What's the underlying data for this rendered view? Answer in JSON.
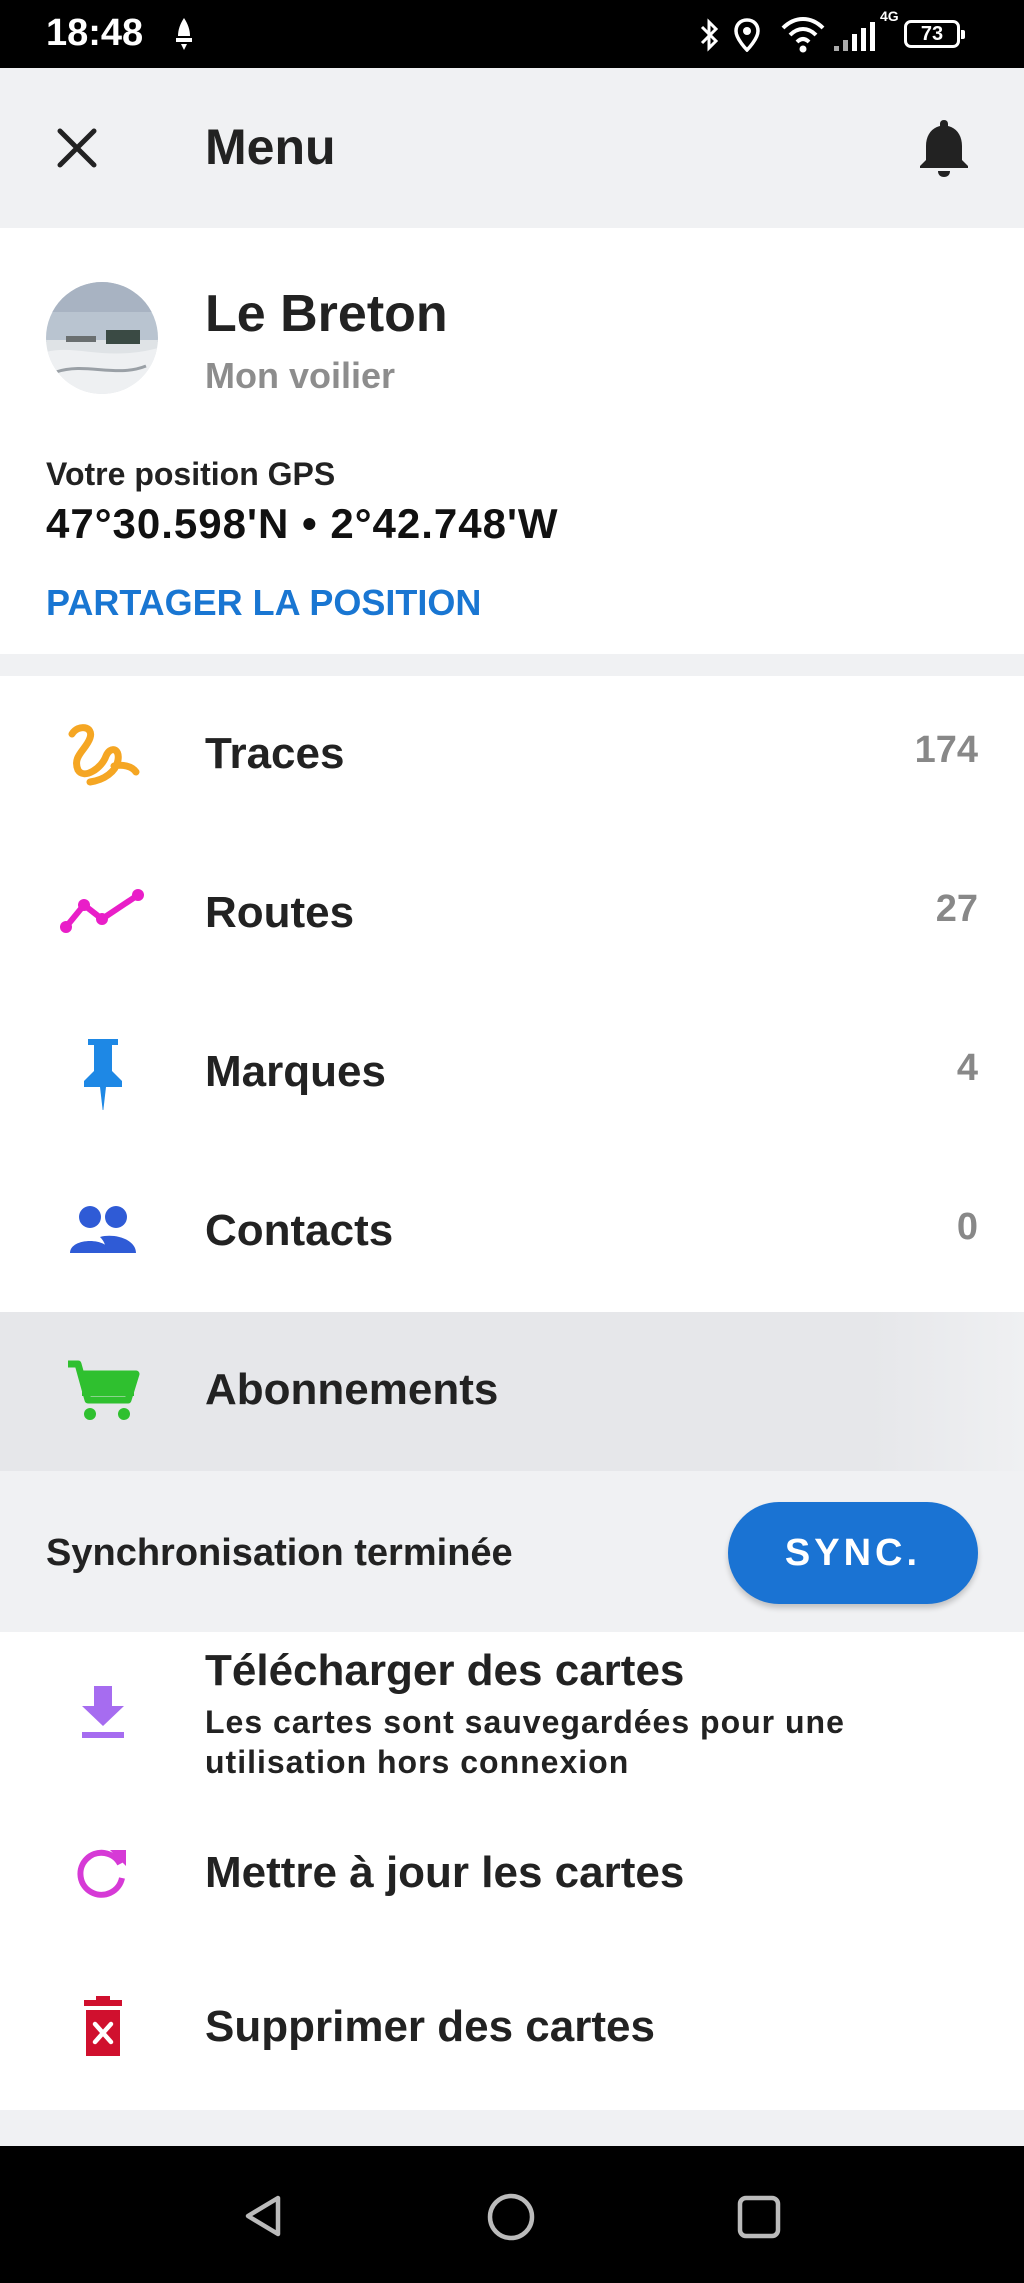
{
  "status_bar": {
    "time": "18:48",
    "battery": "73",
    "network": "4G"
  },
  "header": {
    "title": "Menu"
  },
  "profile": {
    "name": "Le Breton",
    "boat": "Mon voilier",
    "gps_label": "Votre position GPS",
    "gps_value": "47°30.598'N • 2°42.748'W",
    "share_label": "PARTAGER LA POSITION"
  },
  "menu": {
    "traces": {
      "label": "Traces",
      "count": "174"
    },
    "routes": {
      "label": "Routes",
      "count": "27"
    },
    "marques": {
      "label": "Marques",
      "count": "4"
    },
    "contacts": {
      "label": "Contacts",
      "count": "0"
    },
    "abonnements": {
      "label": "Abonnements"
    }
  },
  "sync": {
    "status": "Synchronisation terminée",
    "button": "SYNC."
  },
  "maps": {
    "download_title": "Télécharger des cartes",
    "download_subtitle": "Les cartes sont sauvegardées pour une utilisation hors connexion",
    "update": "Mettre à jour les cartes",
    "delete": "Supprimer des cartes"
  },
  "colors": {
    "accent_blue": "#1976d2",
    "traces": "#f5a623",
    "routes": "#e91ec8",
    "marques": "#1e88e5",
    "contacts": "#2f5bd6",
    "abonnements": "#2fc02f",
    "download": "#a66cf0",
    "update": "#d63ad6",
    "delete": "#d0102e"
  }
}
